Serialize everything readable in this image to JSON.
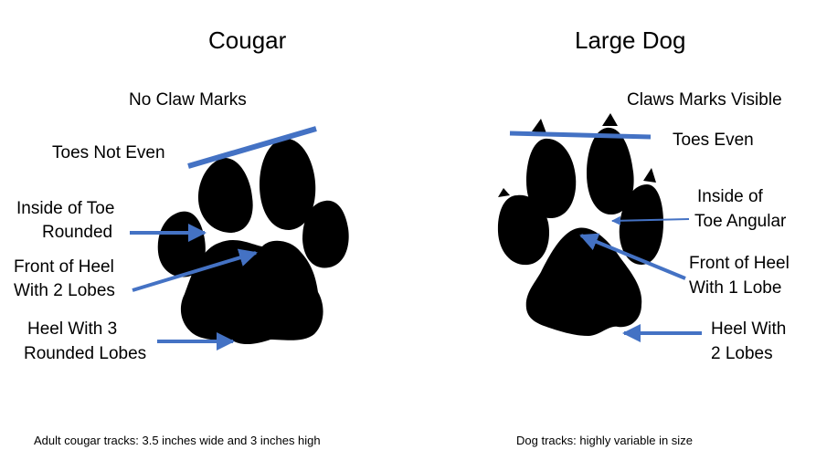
{
  "cougar": {
    "title": "Cougar",
    "no_claw": "No Claw Marks",
    "toes_not_even": "Toes Not Even",
    "inside_toe_1": "Inside of Toe",
    "inside_toe_2": "Rounded",
    "front_heel_1": "Front of Heel",
    "front_heel_2": "With 2 Lobes",
    "heel_1": "Heel With 3",
    "heel_2": "Rounded Lobes",
    "footnote": "Adult cougar tracks: 3.5 inches wide and 3 inches high"
  },
  "dog": {
    "title": "Large Dog",
    "claws": "Claws Marks Visible",
    "toes_even": "Toes Even",
    "inside_toe_1": "Inside of",
    "inside_toe_2": "Toe Angular",
    "front_heel_1": "Front of Heel",
    "front_heel_2": "With 1 Lobe",
    "heel_1": "Heel With",
    "heel_2": "2 Lobes",
    "footnote": "Dog tracks:  highly variable in size"
  },
  "colors": {
    "arrow": "#4472c4",
    "print": "#000000"
  }
}
